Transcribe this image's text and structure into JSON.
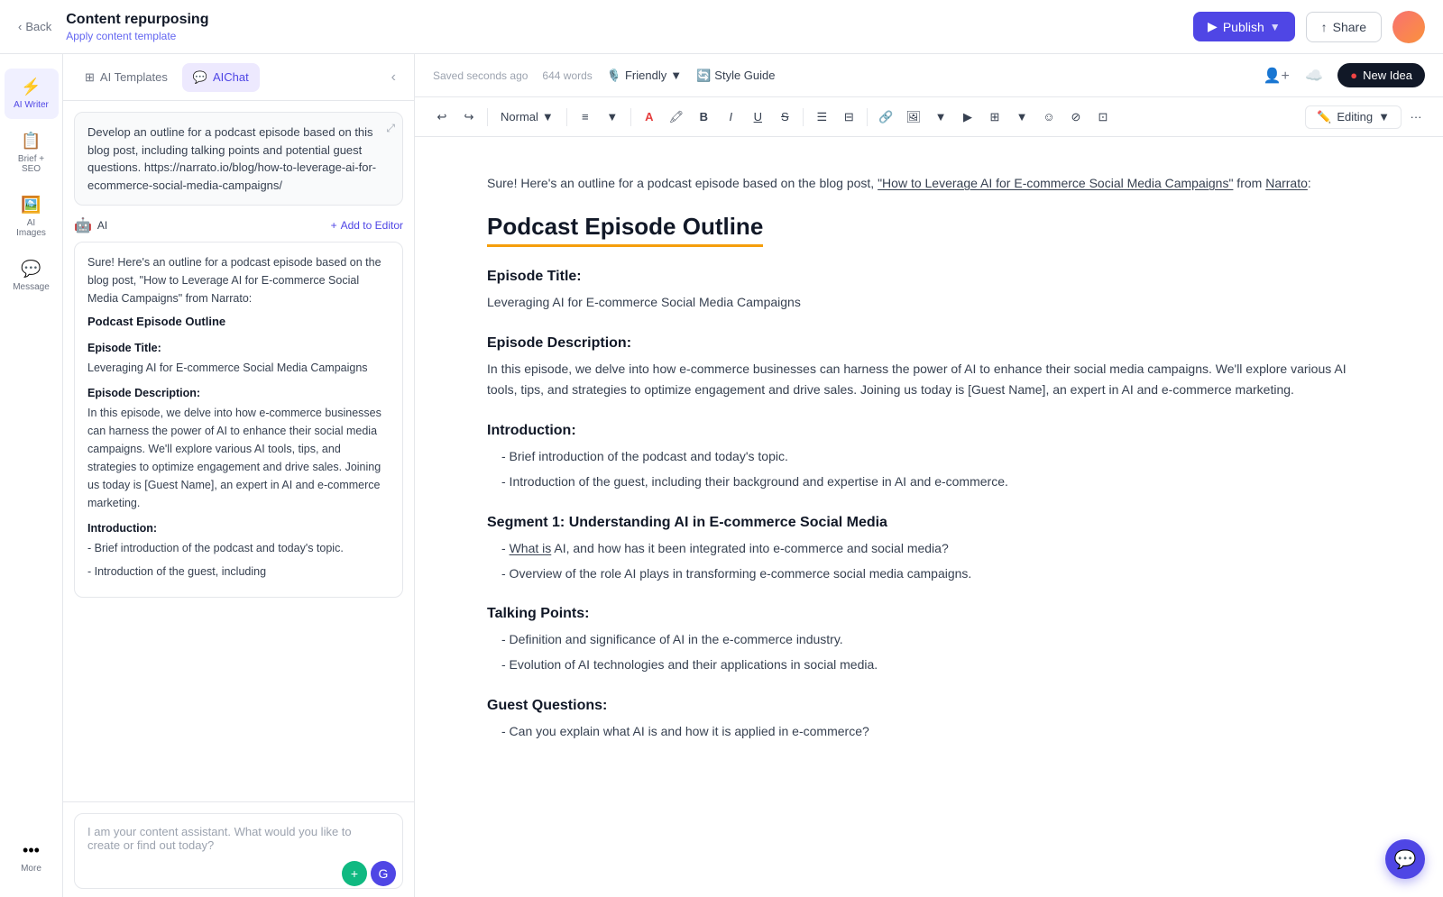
{
  "header": {
    "back_label": "Back",
    "title": "Content repurposing",
    "subtitle": "Apply content template",
    "publish_label": "Publish",
    "share_label": "Share"
  },
  "sidebar": {
    "items": [
      {
        "id": "ai-writer",
        "label": "AI Writer",
        "icon": "⚡"
      },
      {
        "id": "brief-seo",
        "label": "Brief + SEO",
        "icon": "📋"
      },
      {
        "id": "ai-images",
        "label": "AI Images",
        "icon": "🖼️"
      },
      {
        "id": "message",
        "label": "Message",
        "icon": "💬"
      },
      {
        "id": "more",
        "label": "More",
        "icon": "···"
      }
    ]
  },
  "panel": {
    "tabs": [
      {
        "id": "ai-templates",
        "label": "AI Templates",
        "icon": "⊞"
      },
      {
        "id": "aichat",
        "label": "AIChat",
        "icon": "💬",
        "active": true
      }
    ],
    "collapse_label": "‹",
    "user_message": "Develop an outline for a podcast episode based on this blog post, including talking points and potential guest questions. https://narrato.io/blog/how-to-leverage-ai-for-ecommerce-social-media-campaigns/",
    "ai_label": "AI",
    "add_to_editor_label": "Add to Editor",
    "ai_response": {
      "intro": "Sure! Here's an outline for a podcast episode based on the blog post, \"How to Leverage AI for E-commerce Social Media Campaigns\" from Narrato:",
      "title": "Podcast Episode Outline",
      "sections": [
        {
          "heading": "Episode Title:",
          "content": "Leveraging AI for E-commerce Social Media Campaigns"
        },
        {
          "heading": "Episode Description:",
          "content": "In this episode, we delve into how e-commerce businesses can harness the power of AI to enhance their social media campaigns. We'll explore various AI tools, tips, and strategies to optimize engagement and drive sales. Joining us today is [Guest Name], an expert in AI and e-commerce marketing."
        },
        {
          "heading": "Introduction:",
          "items": [
            "- Brief introduction of the podcast and today's topic.",
            "- Introduction of the guest, including their background and expertise in AI and e-commerce."
          ]
        }
      ]
    },
    "input_placeholder": "I am your content assistant. What would you like to create or find out today?"
  },
  "editor": {
    "save_status": "Saved seconds ago",
    "word_count": "644 words",
    "tone_label": "Friendly",
    "style_guide_label": "Style Guide",
    "new_idea_label": "New Idea",
    "format_style": "Normal",
    "editing_label": "Editing",
    "content": {
      "intro": "Sure! Here's an outline for a podcast episode based on the blog post, \"How to Leverage AI for E-commerce Social Media Campaigns\" from Narrato:",
      "title": "Podcast Episode Outline",
      "sections": [
        {
          "heading": "Episode Title:",
          "body": "Leveraging AI for E-commerce Social Media Campaigns"
        },
        {
          "heading": "Episode Description:",
          "body": "In this episode, we delve into how e-commerce businesses can harness the power of AI to enhance their social media campaigns. We'll explore various AI tools, tips, and strategies to optimize engagement and drive sales. Joining us today is [Guest Name], an expert in AI and e-commerce marketing."
        },
        {
          "heading": "Introduction:",
          "items": [
            "- Brief introduction of the podcast and today's topic.",
            "- Introduction of the guest, including their background and expertise in AI and e-commerce."
          ]
        },
        {
          "heading": "Segment 1: Understanding AI in E-commerce Social Media",
          "items": [
            "- What is AI, and how has it been integrated into e-commerce and social media?",
            "- Overview of the role AI plays in transforming e-commerce social media campaigns."
          ]
        },
        {
          "heading": "Talking Points:",
          "items": [
            "- Definition and significance of AI in the e-commerce industry.",
            "- Evolution of AI technologies and their applications in social media."
          ]
        },
        {
          "heading": "Guest Questions:",
          "items": [
            "- Can you explain what AI is and how it is applied in e-commerce?"
          ]
        }
      ]
    }
  }
}
